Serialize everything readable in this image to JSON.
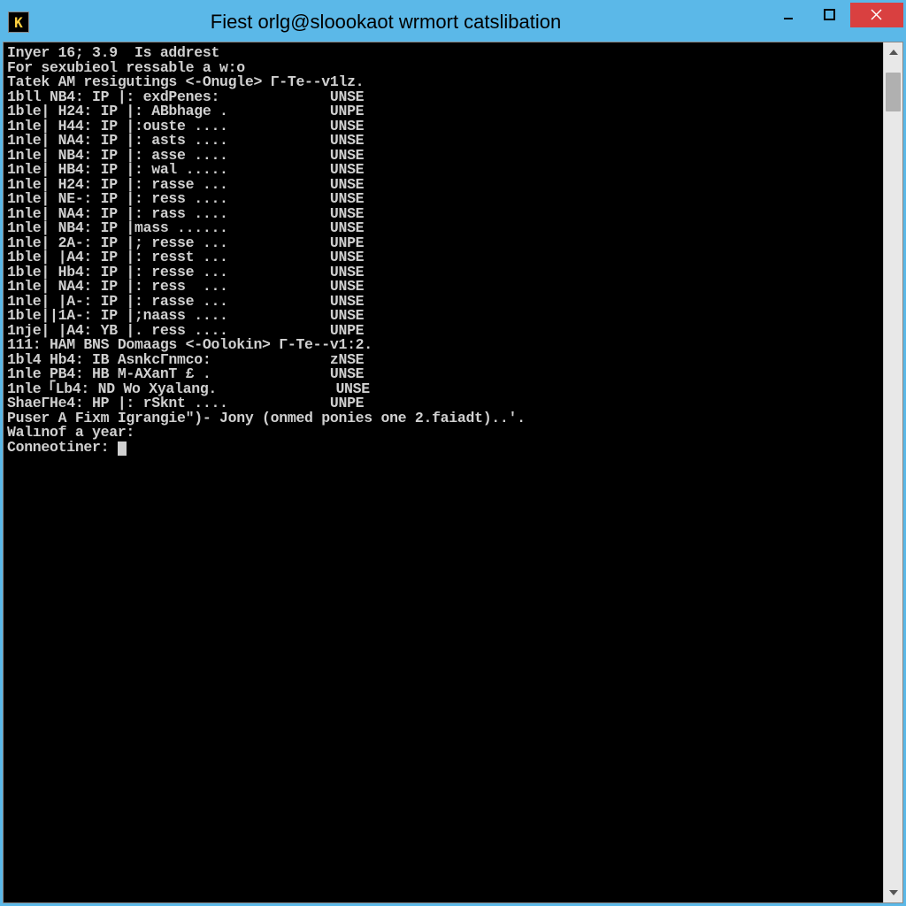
{
  "window": {
    "title": "Fiest orlg@sloookaot wrmort catslibation",
    "app_icon_glyph": "K"
  },
  "terminal": {
    "header": [
      "Inyer 16; 3.9  Is addrest",
      "For sexubieol ressable a w:o",
      ""
    ],
    "section1_header": "Tatek AM resigutings <-Onugle> Γ-Te--v1lz.",
    "section1_rows": [
      {
        "label": "1bll NB4: IP |: exdPenes:",
        "status": "UNSE"
      },
      {
        "label": "1ble| H24: IP |: ABbhage .",
        "status": "UNPE"
      },
      {
        "label": "1nle| H44: IP |:ouste ....",
        "status": "UNSE"
      },
      {
        "label": "1nle| NA4: IP |: asts ....",
        "status": "UNSE"
      },
      {
        "label": "1nle| NB4: IP |: asse ....",
        "status": "UNSE"
      },
      {
        "label": "1nle| HB4: IP |: wal .....",
        "status": "UNSE"
      },
      {
        "label": "1nle| H24: IP |: rasse ...",
        "status": "UNSE"
      },
      {
        "label": "1nle| NE-: IP |: ress ....",
        "status": "UNSE"
      },
      {
        "label": "1nle| NA4: IP |: rass ....",
        "status": "UNSE"
      },
      {
        "label": "1nle| NB4: IP |mass ......",
        "status": "UNSE"
      },
      {
        "label": "1nle| 2A-: IP |; resse ...",
        "status": "UNPE"
      },
      {
        "label": "1ble| |A4: IP |: resst ...",
        "status": "UNSE"
      },
      {
        "label": "1ble| Hb4: IP |: resse ...",
        "status": "UNSE"
      },
      {
        "label": "1nle| NA4: IP |: ress  ...",
        "status": "UNSE"
      },
      {
        "label": "1nle| |A-: IP |: rasse ...",
        "status": "UNSE"
      },
      {
        "label": "1ble||1A-: IP |;naass ....",
        "status": "UNSE"
      },
      {
        "label": "1nje| |A4: YB |. ress ....",
        "status": "UNPE"
      }
    ],
    "section2_header": "111: HAM BNS Domaags <-Oolokin> Γ-Te--v1:2.",
    "section2_rows": [
      {
        "label": "1bl4 Hb4: IB AsnkcΓnmco:",
        "status": "zNSE"
      },
      {
        "label": "1nle PB4: HB M-AXanT £ .",
        "status": "UNSE"
      },
      {
        "label": "1nle「Lb4: ND Wo Xyalang.",
        "status": "UNSE"
      },
      {
        "label": "ShaeΓHe4: HP |: rSknt ....",
        "status": "UNPE"
      }
    ],
    "footer_line": "Puser A Fixm Igrangie\")- Jony (onmed ponies one 2.faiadt)..'.",
    "prompt1": "Walınof a year:",
    "prompt2": "Conneotiner: "
  }
}
